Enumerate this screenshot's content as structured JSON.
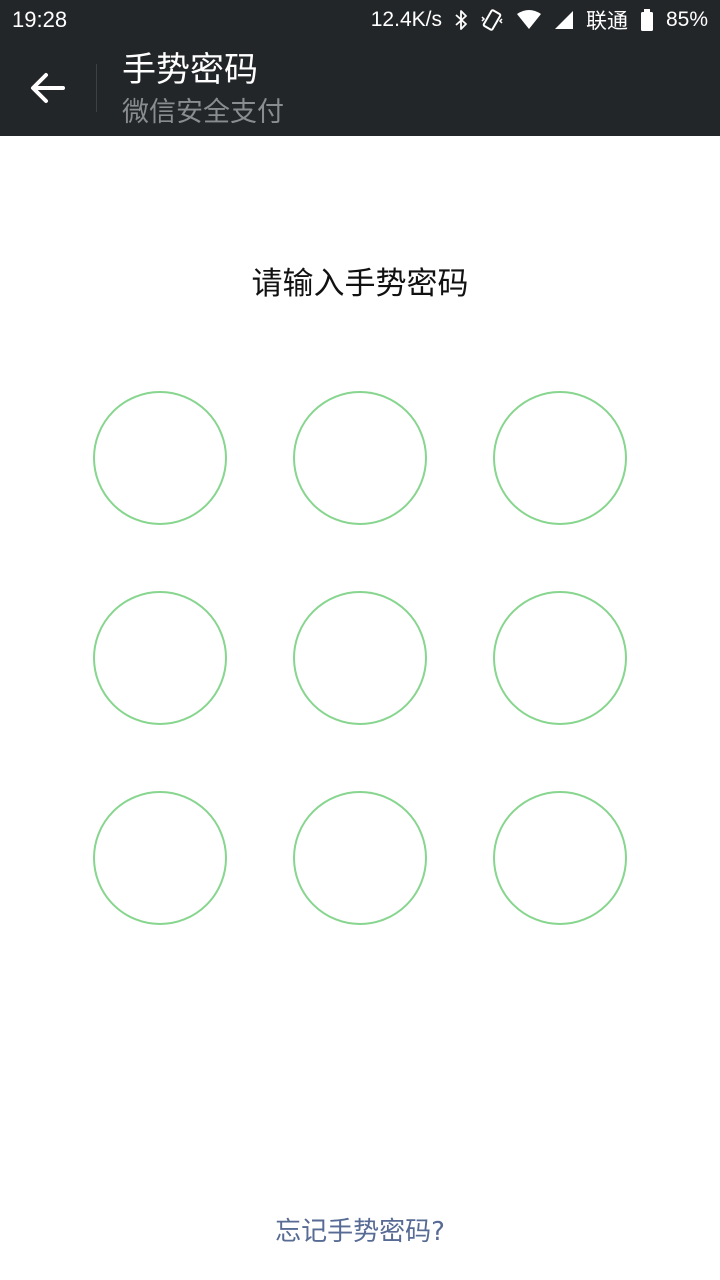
{
  "status_bar": {
    "time": "19:28",
    "net_speed": "12.4K/s",
    "carrier": "联通",
    "battery": "85%",
    "icons": [
      "bluetooth-icon",
      "vibrate-icon",
      "wifi-icon",
      "signal-icon",
      "battery-icon"
    ]
  },
  "header": {
    "back_icon": "arrow-left-icon",
    "title": "手势密码",
    "subtitle": "微信安全支付"
  },
  "main": {
    "prompt": "请输入手势密码",
    "pattern_nodes": [
      1,
      2,
      3,
      4,
      5,
      6,
      7,
      8,
      9
    ],
    "forgot_link": "忘记手势密码?"
  },
  "colors": {
    "bar_background": "#232629",
    "node_stroke": "#87d58e",
    "link": "#576b95",
    "subtitle": "#8a8d90"
  }
}
